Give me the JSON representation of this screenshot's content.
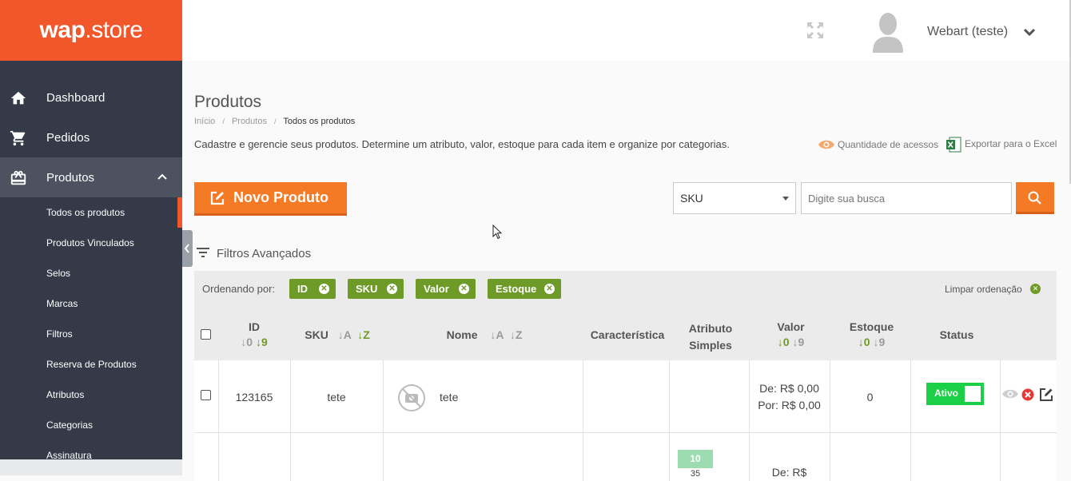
{
  "brand": {
    "logo_text_bold": "wap",
    "logo_text_rest": ".store"
  },
  "sidebar": {
    "items": [
      {
        "label": "Dashboard",
        "icon": "home-icon"
      },
      {
        "label": "Pedidos",
        "icon": "cart-icon"
      },
      {
        "label": "Produtos",
        "icon": "gift-icon"
      }
    ],
    "subitems": [
      "Todos os produtos",
      "Produtos Vinculados",
      "Selos",
      "Marcas",
      "Filtros",
      "Reserva de Produtos",
      "Atributos",
      "Categorias",
      "Assinatura"
    ]
  },
  "header": {
    "user_name": "Webart (teste)"
  },
  "page": {
    "title": "Produtos",
    "breadcrumb": [
      "Início",
      "Produtos",
      "Todos os produtos"
    ],
    "description": "Cadastre e gerencie seus produtos. Determine um atributo, valor, estoque para cada item e organize por categorias.",
    "access_count_label": "Quantidade de acessos",
    "export_label": "Exportar para o Excel",
    "new_product_label": "Novo Produto",
    "search_field_value": "SKU",
    "search_placeholder": "Digite sua busca",
    "filters_label": "Filtros Avançados"
  },
  "ordering": {
    "label": "Ordenando por:",
    "pills": [
      "ID",
      "SKU",
      "Valor",
      "Estoque"
    ],
    "clear_label": "Limpar ordenação"
  },
  "table": {
    "headers": {
      "id": "ID",
      "id_sort_a": "↓0",
      "id_sort_b": "↓9",
      "sku": "SKU",
      "sku_sort_a": "↓A",
      "sku_sort_b": "↓Z",
      "nome": "Nome",
      "nome_sort_a": "↓A",
      "nome_sort_b": "↓Z",
      "caracteristica": "Característica",
      "atributo_1": "Atributo",
      "atributo_2": "Simples",
      "valor": "Valor",
      "valor_sort_a": "↓0",
      "valor_sort_b": "↓9",
      "estoque": "Estoque",
      "estoque_sort_a": "↓0",
      "estoque_sort_b": "↓9",
      "status": "Status"
    },
    "rows": [
      {
        "id": "123165",
        "sku": "tete",
        "nome": "tete",
        "valor_de": "De: R$ 0,00",
        "valor_por": "Por: R$ 0,00",
        "estoque": "0",
        "status": "Ativo"
      }
    ],
    "partial_row": {
      "badge": "10",
      "sub": "35",
      "valor_de": "De: R$"
    }
  },
  "colors": {
    "brand_orange": "#f2562b",
    "button_orange": "#f47a25",
    "sidebar": "#343a48",
    "pill_green": "#6e9a27",
    "status_green": "#1bd046"
  }
}
